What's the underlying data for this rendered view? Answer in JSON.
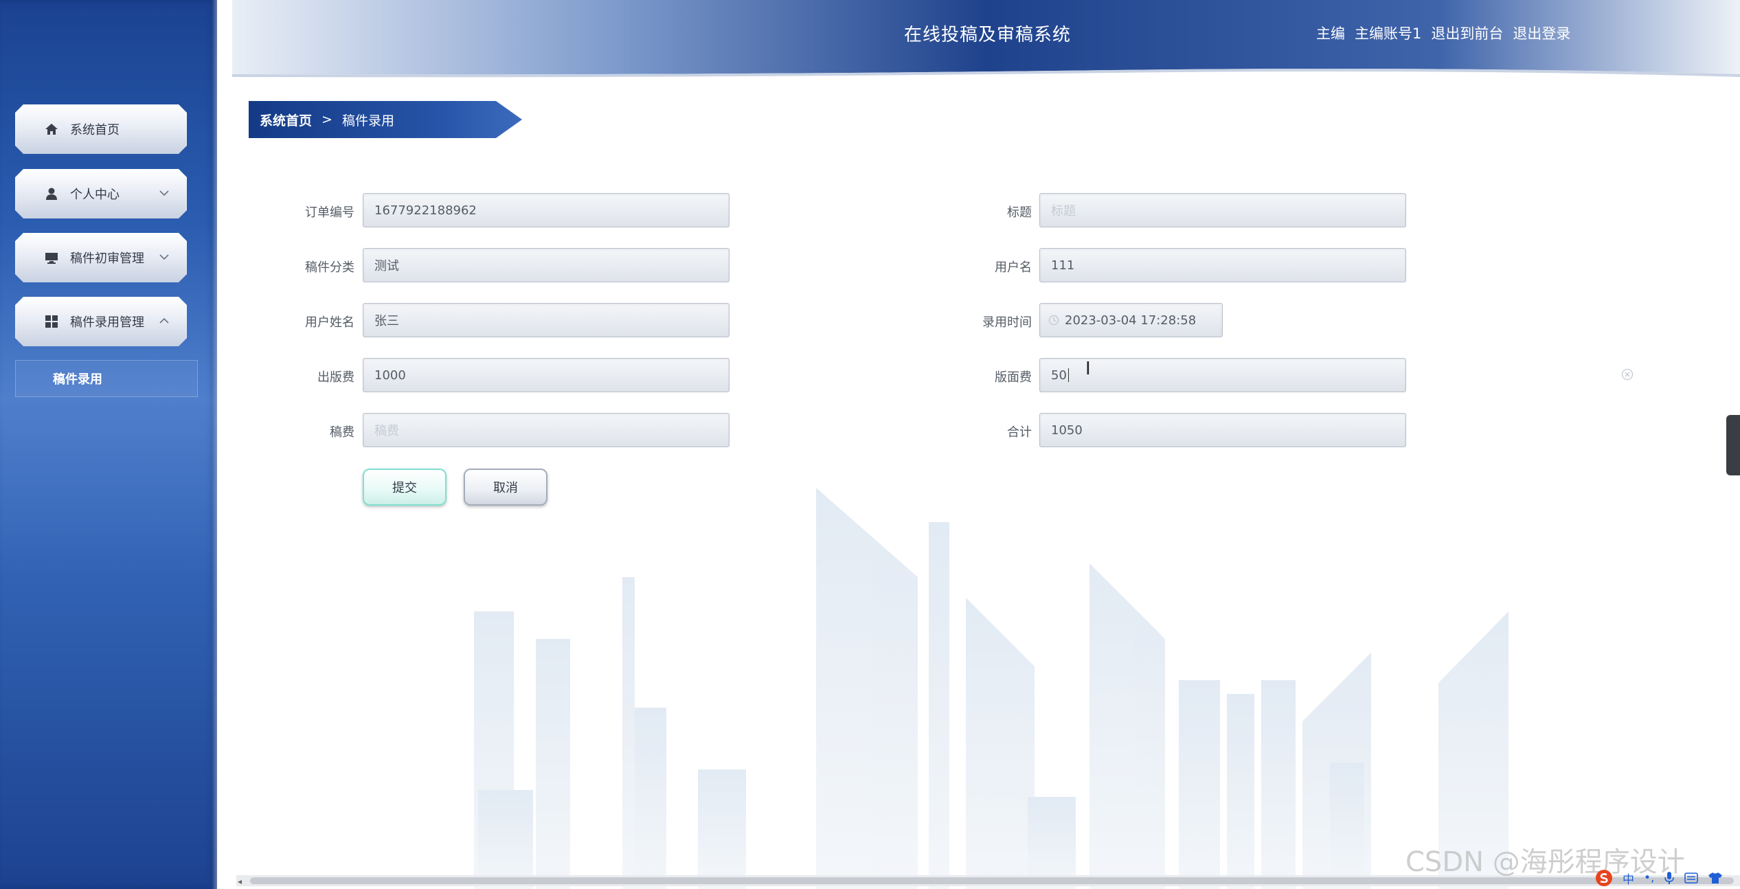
{
  "header": {
    "app_title": "在线投稿及审稿系统",
    "user_role": "主编",
    "username": "主编账号1",
    "exit_to_front": "退出到前台",
    "logout": "退出登录"
  },
  "sidebar": {
    "items": [
      {
        "label": "系统首页",
        "icon": "home-icon",
        "expandable": false
      },
      {
        "label": "个人中心",
        "icon": "user-icon",
        "expandable": true,
        "expanded": false
      },
      {
        "label": "稿件初审管理",
        "icon": "monitor-icon",
        "expandable": true,
        "expanded": false
      },
      {
        "label": "稿件录用管理",
        "icon": "grid-icon",
        "expandable": true,
        "expanded": true
      }
    ],
    "submenu": {
      "label": "稿件录用"
    }
  },
  "breadcrumb": {
    "home": "系统首页",
    "separator": ">",
    "current": "稿件录用"
  },
  "form": {
    "order_no": {
      "label": "订单编号",
      "value": "1677922188962"
    },
    "title": {
      "label": "标题",
      "placeholder": "标题"
    },
    "category": {
      "label": "稿件分类",
      "value": "测试"
    },
    "account": {
      "label": "用户名",
      "value": "111"
    },
    "real_name": {
      "label": "用户姓名",
      "value": "张三"
    },
    "hire_time": {
      "label": "录用时间",
      "value": "2023-03-04 17:28:58"
    },
    "publish_fee": {
      "label": "出版费",
      "value": "1000"
    },
    "layout_fee": {
      "label": "版面费",
      "value": "50"
    },
    "royalty": {
      "label": "稿费",
      "placeholder": "稿费"
    },
    "total": {
      "label": "合计",
      "value": "1050"
    }
  },
  "buttons": {
    "submit": "提交",
    "cancel": "取消"
  },
  "watermark": "CSDN @海彤程序设计",
  "tray": {
    "ime_mode": "中"
  },
  "colors": {
    "sidebar_blue": "#2a5cb0",
    "breadcrumb_blue": "#143a86",
    "submit_border": "#7fe0cf"
  }
}
